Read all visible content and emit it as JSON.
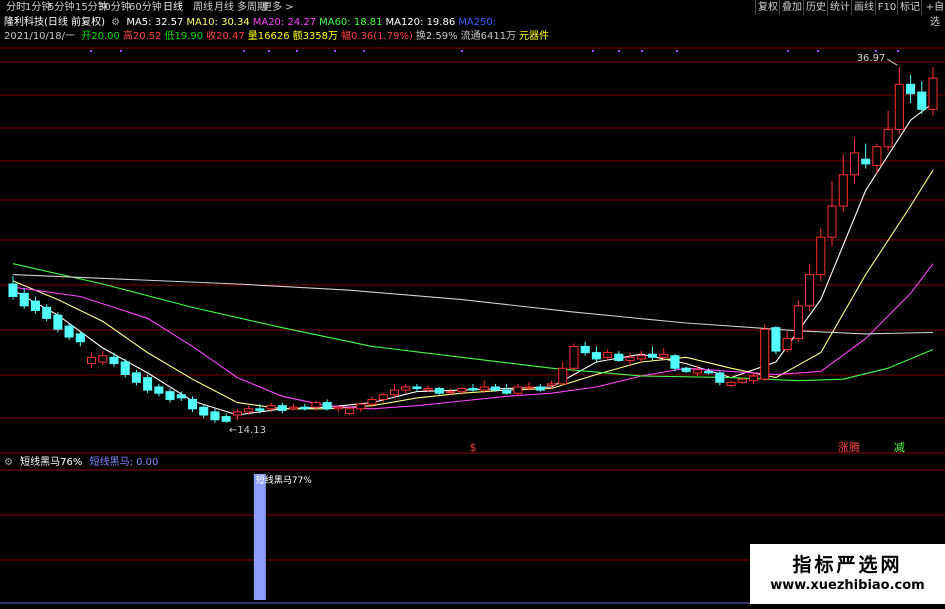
{
  "toolbar": {
    "periods": [
      "分时",
      "1分钟",
      "5分钟",
      "15分钟",
      "30分钟",
      "60分钟",
      "日线",
      "周线",
      "月线",
      "多周期",
      "更多 >"
    ],
    "right_buttons": [
      "复权",
      "叠加",
      "历史",
      "统计",
      "画线",
      "F10",
      "标记",
      "+自选"
    ]
  },
  "header": {
    "stock_name": "隆利科技(日线 前复权)",
    "ma_items": [
      {
        "label": "MA5: 32.57",
        "color": "#ffffff"
      },
      {
        "label": "MA10: 30.34",
        "color": "#ffff66"
      },
      {
        "label": "MA20: 24.27",
        "color": "#ff44ff"
      },
      {
        "label": "MA60: 18.81",
        "color": "#44ff44"
      },
      {
        "label": "MA120: 19.86",
        "color": "#ffffff"
      },
      {
        "label": "MA250:",
        "color": "#3a5cff"
      }
    ]
  },
  "quote": {
    "date": "2021/10/18/一",
    "items": [
      {
        "label": "开",
        "value": "20.00",
        "color": "#00e000"
      },
      {
        "label": "高",
        "value": "20.52",
        "color": "#ff4040"
      },
      {
        "label": "低",
        "value": "19.90",
        "color": "#00e000"
      },
      {
        "label": "收",
        "value": "20.47",
        "color": "#ff4040"
      },
      {
        "label": "量",
        "value": "16626",
        "color": "#ffff00"
      },
      {
        "label": "额",
        "value": "3358万",
        "color": "#ffff00"
      },
      {
        "label": "幅",
        "value": "0.36(1.79%)",
        "color": "#ff4040"
      },
      {
        "label": "换",
        "value": "2.59%",
        "color": "#c8c8c8"
      },
      {
        "label": "流通",
        "value": "6411万",
        "color": "#c8c8c8"
      },
      {
        "label": "",
        "value": "元器件",
        "color": "#ffff00"
      }
    ]
  },
  "colors": {
    "up": "#ff3030",
    "down": "#54ffff",
    "grid": "#7a0000"
  },
  "chart_data": {
    "type": "candlestick",
    "ylim": [
      13,
      38
    ],
    "annotations": {
      "high_label": "36.97",
      "low_label": "14.13"
    },
    "candles": [
      [
        23.0,
        22.2,
        23.5,
        22.0
      ],
      [
        22.4,
        21.6,
        22.7,
        21.4
      ],
      [
        21.9,
        21.3,
        22.2,
        21.1
      ],
      [
        21.5,
        20.8,
        21.7,
        20.6
      ],
      [
        21.0,
        20.1,
        21.2,
        19.9
      ],
      [
        20.3,
        19.6,
        20.5,
        19.4
      ],
      [
        19.8,
        19.3,
        20.0,
        19.0
      ],
      [
        17.9,
        18.3,
        18.6,
        17.6
      ],
      [
        18.0,
        18.4,
        18.7,
        17.8
      ],
      [
        18.3,
        17.9,
        18.6,
        17.7
      ],
      [
        18.0,
        17.2,
        18.2,
        17.0
      ],
      [
        17.3,
        16.7,
        17.5,
        16.5
      ],
      [
        17.0,
        16.2,
        17.2,
        16.0
      ],
      [
        16.4,
        16.0,
        16.6,
        15.8
      ],
      [
        16.1,
        15.6,
        16.3,
        15.4
      ],
      [
        15.9,
        15.7,
        16.1,
        15.5
      ],
      [
        15.6,
        15.0,
        15.8,
        14.8
      ],
      [
        15.1,
        14.6,
        15.3,
        14.4
      ],
      [
        14.8,
        14.3,
        15.0,
        14.1
      ],
      [
        14.5,
        14.2,
        14.7,
        14.1
      ],
      [
        14.6,
        14.8,
        15.0,
        14.3
      ],
      [
        14.8,
        15.0,
        15.2,
        14.6
      ],
      [
        15.0,
        14.9,
        15.3,
        14.7
      ],
      [
        15.0,
        15.2,
        15.4,
        14.8
      ],
      [
        15.2,
        14.9,
        15.4,
        14.7
      ],
      [
        15.0,
        15.1,
        15.3,
        14.9
      ],
      [
        15.1,
        15.0,
        15.3,
        14.9
      ],
      [
        15.1,
        15.4,
        15.5,
        14.9
      ],
      [
        15.4,
        15.0,
        15.6,
        14.9
      ],
      [
        15.0,
        15.1,
        15.2,
        14.8
      ],
      [
        14.7,
        15.0,
        15.1,
        14.6
      ],
      [
        15.0,
        15.3,
        15.4,
        14.8
      ],
      [
        15.3,
        15.6,
        15.8,
        15.1
      ],
      [
        15.6,
        15.9,
        16.0,
        15.4
      ],
      [
        15.9,
        16.2,
        16.6,
        15.7
      ],
      [
        16.2,
        16.4,
        16.6,
        16.0
      ],
      [
        16.4,
        16.3,
        16.6,
        16.1
      ],
      [
        16.2,
        16.3,
        16.5,
        16.1
      ],
      [
        16.3,
        16.0,
        16.4,
        15.9
      ],
      [
        16.1,
        16.1,
        16.3,
        15.9
      ],
      [
        16.1,
        16.3,
        16.4,
        15.9
      ],
      [
        16.3,
        16.2,
        16.6,
        16.1
      ],
      [
        16.2,
        16.4,
        16.8,
        16.0
      ],
      [
        16.4,
        16.2,
        16.6,
        16.1
      ],
      [
        16.2,
        16.0,
        16.6,
        15.9
      ],
      [
        16.0,
        16.4,
        16.6,
        15.8
      ],
      [
        16.4,
        16.4,
        16.7,
        16.2
      ],
      [
        16.4,
        16.2,
        16.6,
        16.1
      ],
      [
        16.5,
        16.6,
        16.8,
        16.3
      ],
      [
        16.6,
        17.6,
        18.0,
        16.5
      ],
      [
        17.6,
        19.0,
        19.2,
        17.4
      ],
      [
        19.0,
        18.6,
        19.3,
        18.4
      ],
      [
        18.6,
        18.2,
        19.0,
        18.0
      ],
      [
        18.3,
        18.6,
        18.8,
        18.1
      ],
      [
        18.5,
        18.1,
        18.7,
        18.0
      ],
      [
        18.1,
        18.3,
        18.6,
        17.8
      ],
      [
        18.2,
        18.4,
        18.7,
        18.0
      ],
      [
        18.5,
        18.3,
        19.0,
        18.1
      ],
      [
        18.3,
        18.5,
        18.9,
        18.1
      ],
      [
        18.4,
        17.6,
        18.5,
        17.4
      ],
      [
        17.6,
        17.4,
        17.7,
        17.3
      ],
      [
        17.3,
        17.5,
        17.8,
        17.1
      ],
      [
        17.4,
        17.3,
        17.6,
        17.2
      ],
      [
        17.3,
        16.7,
        17.4,
        16.5
      ],
      [
        16.5,
        16.7,
        16.8,
        16.4
      ],
      [
        16.7,
        16.9,
        17.0,
        16.6
      ],
      [
        16.8,
        17.1,
        17.3,
        16.6
      ],
      [
        16.9,
        20.1,
        20.4,
        16.8
      ],
      [
        20.2,
        18.7,
        20.3,
        18.5
      ],
      [
        18.8,
        19.5,
        20.0,
        18.6
      ],
      [
        19.5,
        21.6,
        22.0,
        19.3
      ],
      [
        21.6,
        23.6,
        24.3,
        21.3
      ],
      [
        23.6,
        26.0,
        26.6,
        23.2
      ],
      [
        26.0,
        28.0,
        29.6,
        25.4
      ],
      [
        28.0,
        30.0,
        31.3,
        27.6
      ],
      [
        30.0,
        31.4,
        32.4,
        29.4
      ],
      [
        31.0,
        30.7,
        32.0,
        30.4
      ],
      [
        30.6,
        31.8,
        32.0,
        30.1
      ],
      [
        31.8,
        32.9,
        34.1,
        31.5
      ],
      [
        32.9,
        35.8,
        36.9,
        32.6
      ],
      [
        35.8,
        35.2,
        36.4,
        34.6
      ],
      [
        35.3,
        34.2,
        36.0,
        33.9
      ],
      [
        34.2,
        36.2,
        36.9,
        33.8
      ]
    ],
    "ma_lines": [
      {
        "name": "MA5",
        "color": "#ffffff",
        "points": [
          [
            0,
            22.6
          ],
          [
            4,
            21.0
          ],
          [
            8,
            18.9
          ],
          [
            12,
            17.3
          ],
          [
            16,
            15.5
          ],
          [
            20,
            14.6
          ],
          [
            24,
            15.0
          ],
          [
            28,
            15.1
          ],
          [
            32,
            15.4
          ],
          [
            36,
            16.1
          ],
          [
            40,
            16.2
          ],
          [
            44,
            16.3
          ],
          [
            48,
            16.4
          ],
          [
            52,
            18.0
          ],
          [
            56,
            18.5
          ],
          [
            60,
            17.9
          ],
          [
            64,
            17.0
          ],
          [
            68,
            18.0
          ],
          [
            72,
            22.0
          ],
          [
            76,
            29.0
          ],
          [
            80,
            33.5
          ],
          [
            82,
            34.6
          ]
        ]
      },
      {
        "name": "MA10",
        "color": "#ffff88",
        "points": [
          [
            0,
            23.2
          ],
          [
            4,
            22.0
          ],
          [
            8,
            20.6
          ],
          [
            12,
            18.6
          ],
          [
            16,
            16.9
          ],
          [
            20,
            15.4
          ],
          [
            24,
            15.0
          ],
          [
            28,
            15.0
          ],
          [
            32,
            15.2
          ],
          [
            36,
            15.7
          ],
          [
            40,
            16.0
          ],
          [
            44,
            16.2
          ],
          [
            48,
            16.3
          ],
          [
            52,
            17.2
          ],
          [
            56,
            18.0
          ],
          [
            60,
            18.3
          ],
          [
            64,
            17.6
          ],
          [
            68,
            17.0
          ],
          [
            72,
            18.6
          ],
          [
            76,
            23.6
          ],
          [
            80,
            28.0
          ],
          [
            82,
            30.3
          ]
        ]
      },
      {
        "name": "MA20",
        "color": "#ff44ff",
        "points": [
          [
            0,
            22.8
          ],
          [
            6,
            22.2
          ],
          [
            12,
            20.8
          ],
          [
            16,
            19.0
          ],
          [
            20,
            17.0
          ],
          [
            24,
            15.8
          ],
          [
            28,
            15.2
          ],
          [
            32,
            15.0
          ],
          [
            36,
            15.2
          ],
          [
            40,
            15.5
          ],
          [
            44,
            15.8
          ],
          [
            48,
            16.0
          ],
          [
            52,
            16.4
          ],
          [
            56,
            17.1
          ],
          [
            60,
            17.6
          ],
          [
            64,
            17.4
          ],
          [
            68,
            17.2
          ],
          [
            72,
            17.4
          ],
          [
            76,
            19.5
          ],
          [
            80,
            22.4
          ],
          [
            82,
            24.3
          ]
        ]
      },
      {
        "name": "MA60",
        "color": "#44ff44",
        "points": [
          [
            0,
            24.3
          ],
          [
            8,
            23.0
          ],
          [
            16,
            21.5
          ],
          [
            24,
            20.2
          ],
          [
            32,
            19.0
          ],
          [
            40,
            18.3
          ],
          [
            48,
            17.6
          ],
          [
            56,
            17.1
          ],
          [
            64,
            17.0
          ],
          [
            70,
            16.8
          ],
          [
            74,
            16.9
          ],
          [
            78,
            17.6
          ],
          [
            82,
            18.8
          ]
        ]
      },
      {
        "name": "MA120",
        "color": "#d0d0d0",
        "points": [
          [
            0,
            23.6
          ],
          [
            10,
            23.3
          ],
          [
            20,
            23.0
          ],
          [
            30,
            22.6
          ],
          [
            40,
            22.0
          ],
          [
            50,
            21.2
          ],
          [
            60,
            20.5
          ],
          [
            70,
            20.0
          ],
          [
            76,
            19.8
          ],
          [
            82,
            19.9
          ]
        ]
      }
    ],
    "indicator": {
      "title": "短线黑马76%",
      "series_label": "短线黑马: 0.00",
      "bar_label": "短线黑马77%",
      "bar_index": 22,
      "bar_value": 1.0
    },
    "markers": [
      {
        "index": 41,
        "text": "$",
        "color": "#ff4040"
      },
      {
        "index": 74,
        "text": "涨",
        "color": "#ff4040"
      },
      {
        "index": 75,
        "text": "腾",
        "color": "#ff4040"
      },
      {
        "index": 79,
        "text": "减",
        "color": "#44ff44"
      }
    ]
  },
  "watermark": {
    "title": "指标严选网",
    "url": "www.xuezhibiao.com"
  }
}
